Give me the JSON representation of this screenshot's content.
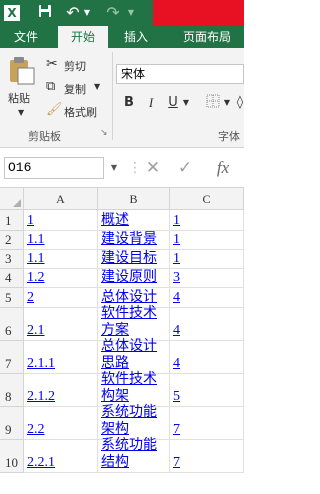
{
  "titlebar": {
    "icons": [
      "excel-icon",
      "save-icon",
      "undo-icon",
      "undo-dropdown-icon",
      "redo-icon"
    ],
    "brand_color": "#217346"
  },
  "tabs": [
    {
      "label": "文件",
      "active": false
    },
    {
      "label": "开始",
      "active": true
    },
    {
      "label": "插入",
      "active": false
    },
    {
      "label": "页面布局",
      "active": false
    }
  ],
  "ribbon": {
    "paste_label": "粘贴",
    "cut_label": "剪切",
    "copy_label": "复制",
    "format_painter_label": "格式刷",
    "clipboard_group": "剪贴板",
    "font_name": "宋体",
    "bold": "B",
    "italic": "I",
    "underline": "U",
    "font_group": "字体"
  },
  "formula_bar": {
    "name_box": "O16",
    "fx": "fx"
  },
  "columns": [
    "A",
    "B",
    "C"
  ],
  "rows": [
    {
      "num": "1",
      "a": "1",
      "b": "概述",
      "c": "1"
    },
    {
      "num": "2",
      "a": "1.1",
      "b": "建设背景",
      "c": "1"
    },
    {
      "num": "3",
      "a": "1.1",
      "b": "建设目标",
      "c": "1"
    },
    {
      "num": "4",
      "a": "1.2",
      "b": "建设原则",
      "c": "3"
    },
    {
      "num": "5",
      "a": "2",
      "b": "总体设计",
      "c": "4"
    },
    {
      "num": "6",
      "a": "2.1",
      "b": "软件技术\n方案",
      "c": "4"
    },
    {
      "num": "7",
      "a": "2.1.1",
      "b": "总体设计\n思路",
      "c": "4"
    },
    {
      "num": "8",
      "a": "2.1.2",
      "b": "软件技术\n构架",
      "c": "5"
    },
    {
      "num": "9",
      "a": "2.2",
      "b": "系统功能\n架构",
      "c": "7"
    },
    {
      "num": "10",
      "a": "2.2.1",
      "b": "系统功能\n结构",
      "c": "7"
    }
  ]
}
